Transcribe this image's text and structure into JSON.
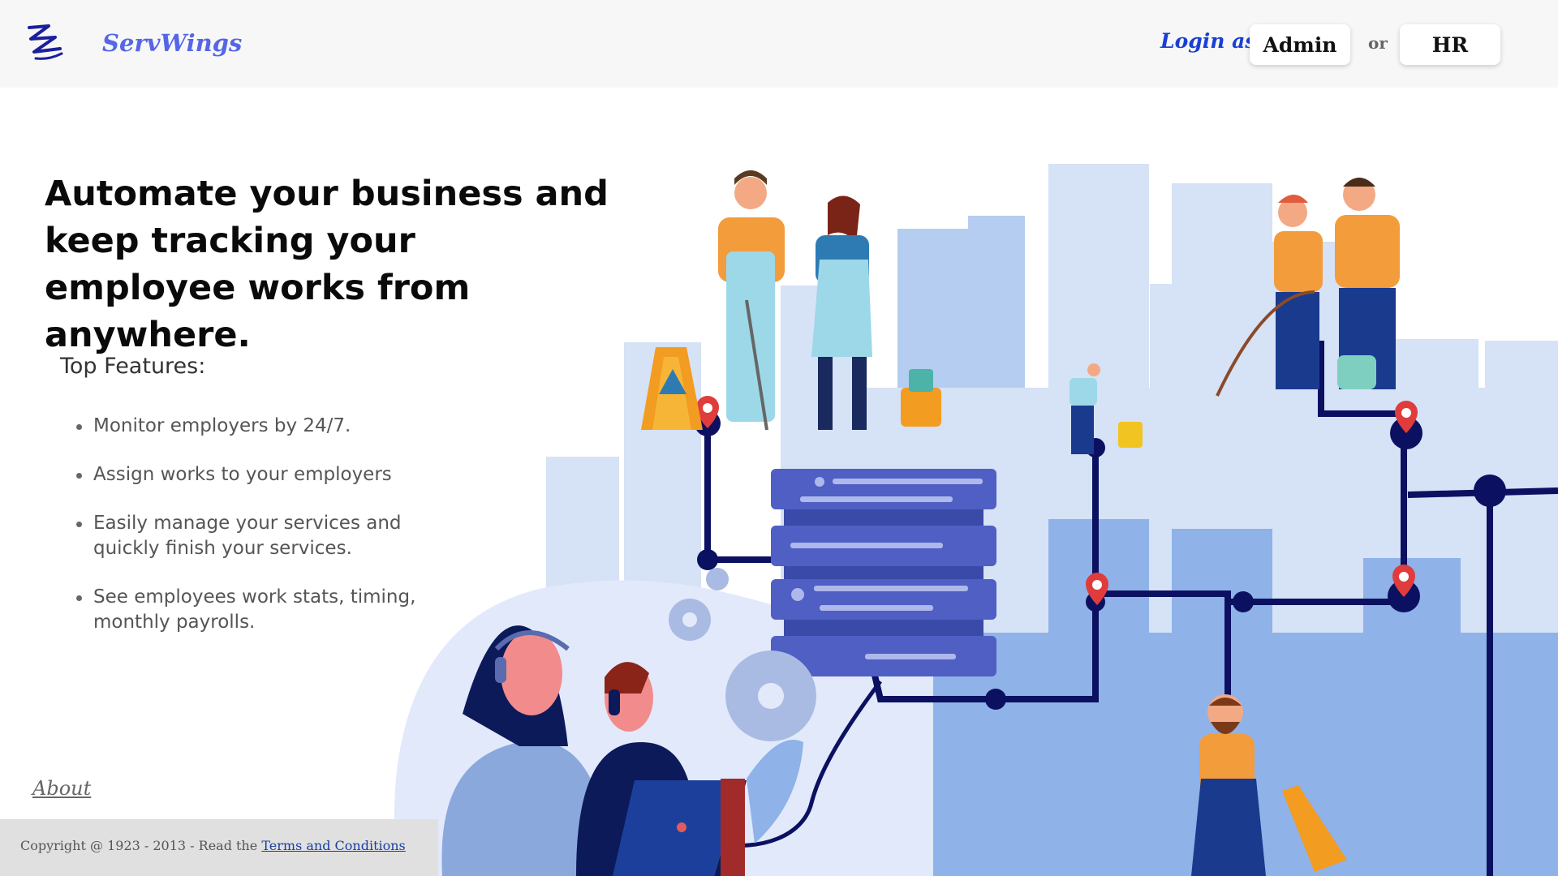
{
  "header": {
    "brand": "ServWings",
    "login_label": "Login as",
    "admin_label": "Admin",
    "or_label": "or",
    "hr_label": "HR"
  },
  "hero": {
    "headline": "Automate your business and keep tracking your employee works from anywhere."
  },
  "features": {
    "title": "Top Features:",
    "items": [
      "Monitor employers by 24/7.",
      "Assign works to your employers",
      "Easily manage your services and quickly finish your services.",
      "See employees work stats, timing, monthly payrolls."
    ]
  },
  "footer": {
    "about_label": "About",
    "copyright": "Copyright @ 1923 - 2013 - Read the",
    "terms_label": "Terms and Conditions"
  },
  "colors": {
    "brand": "#5566e6",
    "login": "#1a3fd6",
    "navy": "#0b1160",
    "server": "#4f5fc4",
    "building_light": "#d6e2f5",
    "building_mid": "#b4cdf0",
    "building_dark": "#8fb2e8"
  },
  "icons": {
    "logo": "servwings-logo-icon",
    "pin": "map-pin-icon",
    "gear": "gear-icon",
    "warning": "warning-sign-icon"
  }
}
